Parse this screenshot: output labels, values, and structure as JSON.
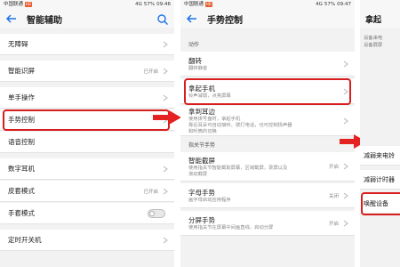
{
  "status": {
    "carrier": "中国联通",
    "hd": "HD",
    "signal": "4G",
    "battery": "57%",
    "time_p1": "09:46",
    "time_p2": "09:47"
  },
  "p1": {
    "title": "智能辅助",
    "rows": [
      {
        "label": "无障碍",
        "value": ""
      },
      {
        "label": "智能识屏",
        "value": "已开启"
      },
      {
        "label": "单手操作",
        "value": ""
      },
      {
        "label": "手势控制",
        "value": ""
      },
      {
        "label": "语音控制",
        "value": ""
      },
      {
        "label": "数字耳机",
        "value": ""
      },
      {
        "label": "皮套模式",
        "value": "已开启"
      },
      {
        "label": "手套模式",
        "value": ""
      },
      {
        "label": "定时开关机",
        "value": ""
      }
    ]
  },
  "p2": {
    "title": "手势控制",
    "section1": "动作",
    "section2": "指关节手势",
    "rows": [
      {
        "label": "翻转",
        "sub": "翻转静音",
        "value": ""
      },
      {
        "label": "拿起手机",
        "sub": "铃声减弱，点亮屏幕",
        "value": ""
      },
      {
        "label": "拿到耳边",
        "sub": "使用拨号盘时，拿起手机",
        "sub2": "靠近耳朵可自动接听、拨打电话，也可控制扬声器",
        "sub3": "和听筒的切换",
        "value": ""
      },
      {
        "label": "智能截屏",
        "sub": "使用指关节智能截取屏幕，区域截屏，录屏以及",
        "sub2": "滚动截屏",
        "value": "开启"
      },
      {
        "label": "字母手势",
        "sub": "画字母启动应用程序",
        "value": "关闭"
      },
      {
        "label": "分屏手势",
        "sub": "使用指关节在屏幕中间画直线，启动分屏",
        "value": "开启"
      }
    ]
  },
  "p3": {
    "title": "拿起",
    "desc1": "设备来电",
    "desc2": "设备屏屏",
    "rows": [
      {
        "label": "减弱来电铃"
      },
      {
        "label": "减弱计时器"
      },
      {
        "label": "唤醒设备"
      }
    ]
  },
  "colors": {
    "highlight": "#d81e1e",
    "accent": "#1a73e8"
  }
}
